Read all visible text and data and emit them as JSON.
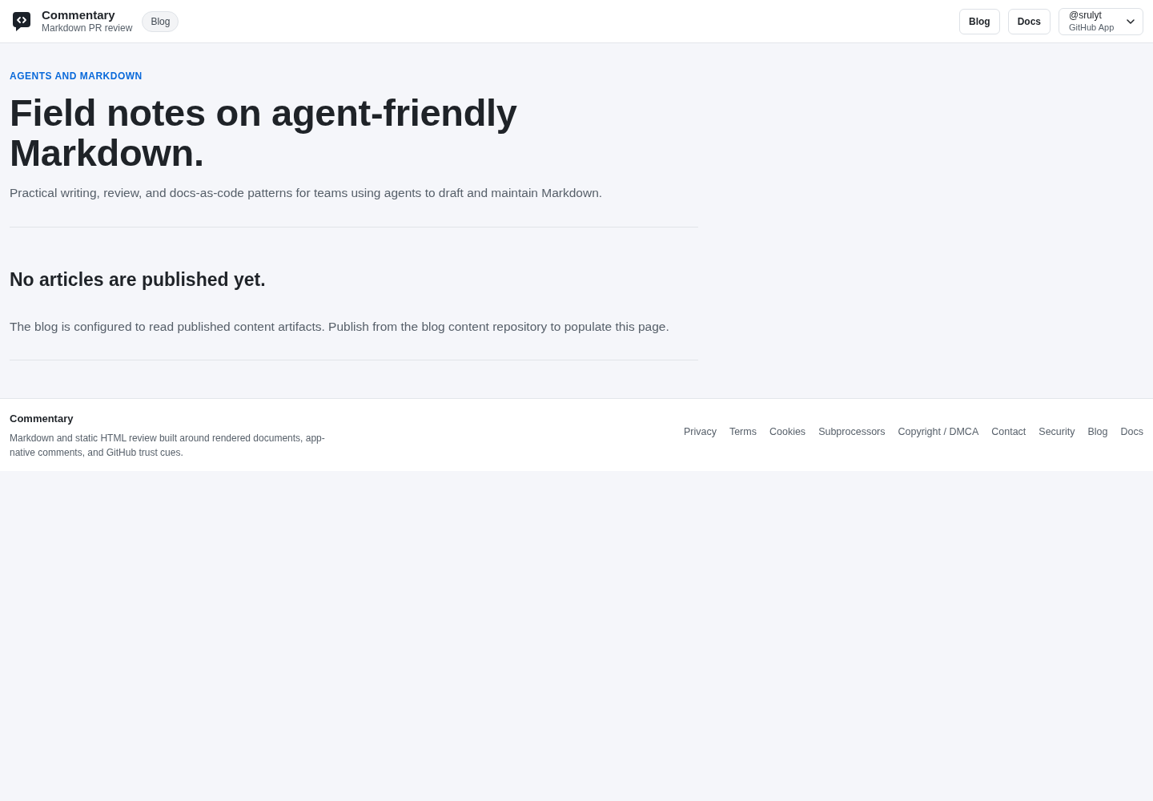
{
  "header": {
    "brand": {
      "name": "Commentary",
      "tagline": "Markdown PR review"
    },
    "section_badge": "Blog",
    "nav": [
      {
        "label": "Blog"
      },
      {
        "label": "Docs"
      }
    ],
    "account": {
      "username": "@srulyt",
      "subtitle": "GitHub App"
    }
  },
  "hero": {
    "eyebrow": "AGENTS AND MARKDOWN",
    "title": "Field notes on agent-friendly Markdown.",
    "subtitle": "Practical writing, review, and docs-as-code patterns for teams using agents to draft and maintain Markdown."
  },
  "empty_state": {
    "title": "No articles are published yet.",
    "message": "The blog is configured to read published content artifacts. Publish from the blog content repository to populate this page."
  },
  "footer": {
    "brand": "Commentary",
    "description": "Markdown and static HTML review built around rendered documents, app-native comments, and GitHub trust cues.",
    "links": [
      "Privacy",
      "Terms",
      "Cookies",
      "Subprocessors",
      "Copyright / DMCA",
      "Contact",
      "Security",
      "Blog",
      "Docs"
    ]
  }
}
